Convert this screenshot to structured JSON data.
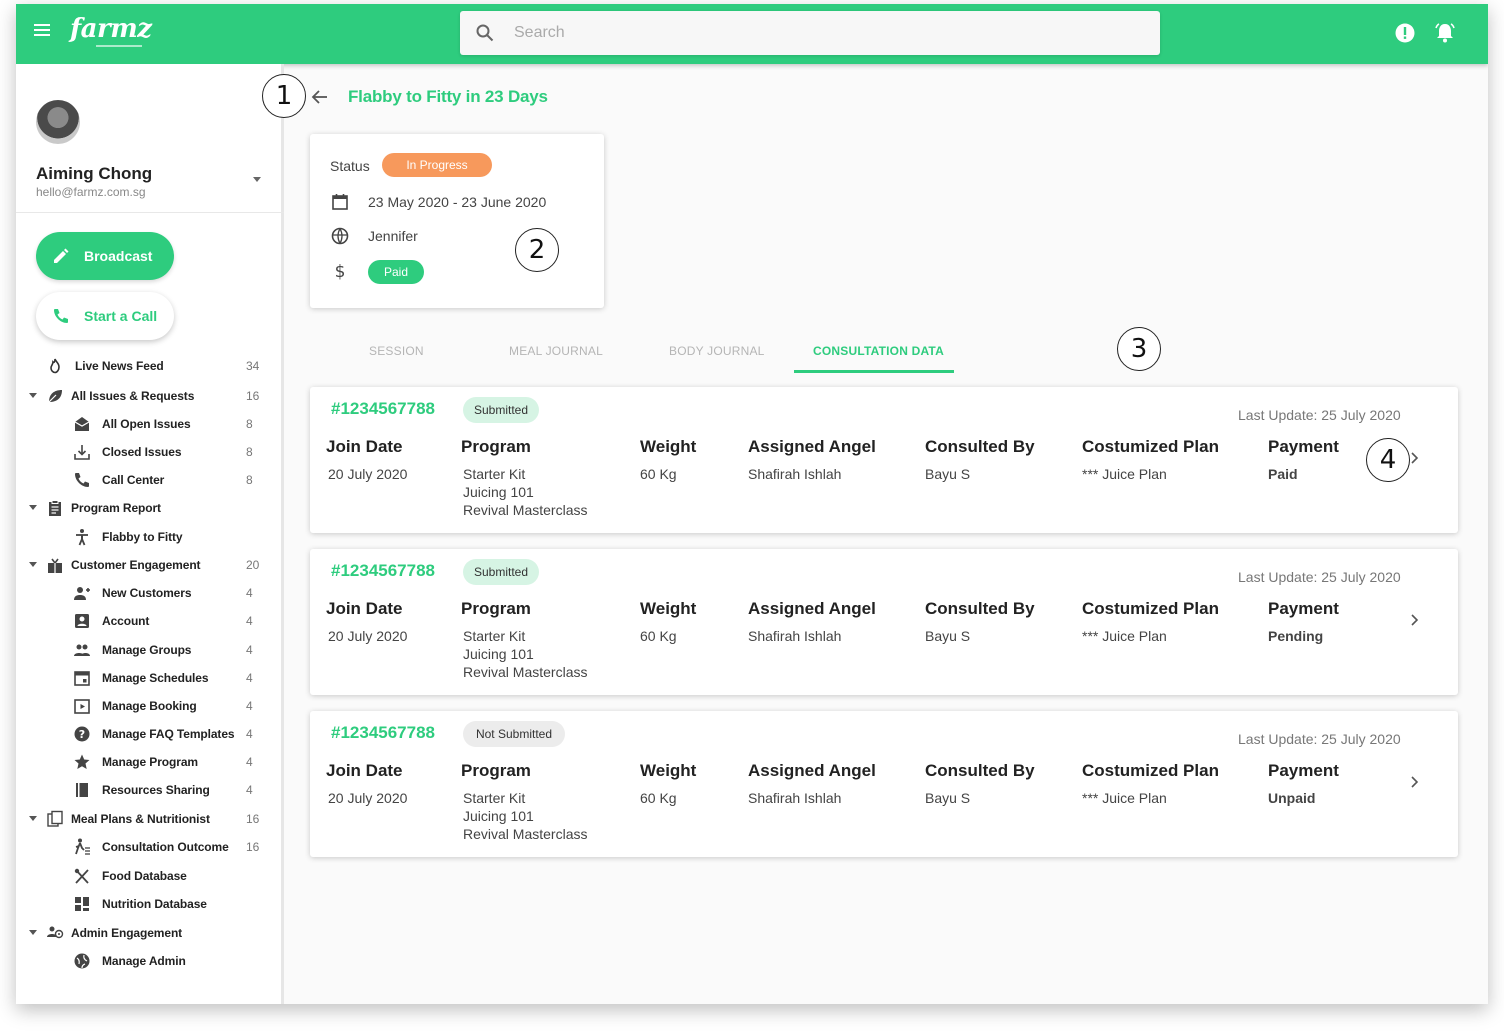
{
  "app": {
    "logo": "farmz"
  },
  "search": {
    "placeholder": "Search"
  },
  "user": {
    "name": "Aiming Chong",
    "email": "hello@farmz.com.sg"
  },
  "actions": {
    "broadcast": "Broadcast",
    "start_call": "Start a Call"
  },
  "sidebar": {
    "items": [
      {
        "label": "Live News Feed",
        "count": "34"
      },
      {
        "label": "All Issues & Requests",
        "count": "16"
      },
      {
        "label": "All Open Issues",
        "count": "8"
      },
      {
        "label": "Closed Issues",
        "count": "8"
      },
      {
        "label": "Call Center",
        "count": "8"
      },
      {
        "label": "Program Report",
        "count": ""
      },
      {
        "label": "Flabby to Fitty",
        "count": ""
      },
      {
        "label": "Customer Engagement",
        "count": "20"
      },
      {
        "label": "New Customers",
        "count": "4"
      },
      {
        "label": "Account",
        "count": "4"
      },
      {
        "label": "Manage Groups",
        "count": "4"
      },
      {
        "label": "Manage Schedules",
        "count": "4"
      },
      {
        "label": "Manage Booking",
        "count": "4"
      },
      {
        "label": "Manage FAQ Templates",
        "count": "4"
      },
      {
        "label": "Manage Program",
        "count": "4"
      },
      {
        "label": "Resources Sharing",
        "count": "4"
      },
      {
        "label": "Meal Plans & Nutritionist",
        "count": "16"
      },
      {
        "label": "Consultation Outcome",
        "count": "16"
      },
      {
        "label": "Food Database",
        "count": ""
      },
      {
        "label": "Nutrition Database",
        "count": ""
      },
      {
        "label": "Admin Engagement",
        "count": ""
      },
      {
        "label": "Manage Admin",
        "count": ""
      }
    ]
  },
  "page": {
    "title": "Flabby to Fitty in 23 Days"
  },
  "callouts": [
    "1",
    "2",
    "3",
    "4"
  ],
  "info": {
    "status_label": "Status",
    "status": "In Progress",
    "dates": "23 May 2020 - 23 June 2020",
    "coach": "Jennifer",
    "payment": "Paid"
  },
  "tabs": [
    "SESSION",
    "MEAL JOURNAL",
    "BODY JOURNAL",
    "CONSULTATION DATA"
  ],
  "columns": {
    "join_date": "Join Date",
    "program": "Program",
    "weight": "Weight",
    "assigned_angel": "Assigned Angel",
    "consulted_by": "Consulted By",
    "plan": "Costumized Plan",
    "payment": "Payment"
  },
  "records": [
    {
      "id": "#1234567788",
      "status": "Submitted",
      "last_update": "Last  Update: 25 July 2020",
      "join_date": "20 July 2020",
      "program": [
        "Starter Kit",
        "Juicing 101",
        "Revival Masterclass"
      ],
      "weight": "60 Kg",
      "angel": "Shafirah Ishlah",
      "consulted_by": "Bayu S",
      "plan": "*** Juice Plan",
      "payment": "Paid"
    },
    {
      "id": "#1234567788",
      "status": "Submitted",
      "last_update": "Last  Update: 25 July 2020",
      "join_date": "20 July 2020",
      "program": [
        "Starter Kit",
        "Juicing 101",
        "Revival Masterclass"
      ],
      "weight": "60 Kg",
      "angel": "Shafirah Ishlah",
      "consulted_by": "Bayu S",
      "plan": "*** Juice Plan",
      "payment": "Pending"
    },
    {
      "id": "#1234567788",
      "status": "Not Submitted",
      "last_update": "Last  Update: 25 July 2020",
      "join_date": "20 July 2020",
      "program": [
        "Starter Kit",
        "Juicing 101",
        "Revival Masterclass"
      ],
      "weight": "60 Kg",
      "angel": "Shafirah Ishlah",
      "consulted_by": "Bayu S",
      "plan": "*** Juice Plan",
      "payment": "Unpaid"
    }
  ],
  "colors": {
    "brand": "#2ecc7e",
    "status_orange": "#f7995c",
    "pending": "#f08a3c",
    "unpaid": "#f05a1c"
  }
}
